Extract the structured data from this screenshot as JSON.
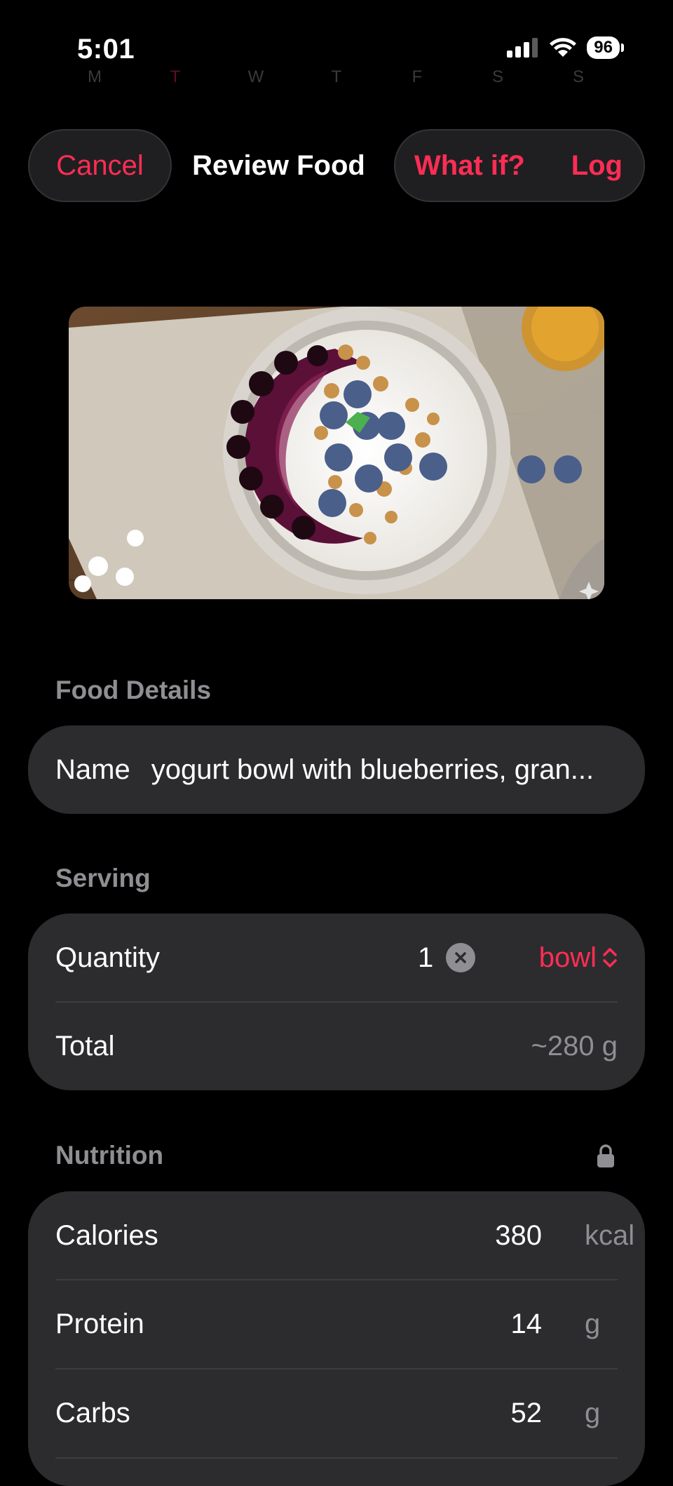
{
  "status_bar": {
    "time": "5:01",
    "battery": "96"
  },
  "week_strip": [
    "M",
    "T",
    "W",
    "T",
    "F",
    "S",
    "S"
  ],
  "nav": {
    "cancel_label": "Cancel",
    "title": "Review Food",
    "what_if_label": "What if?",
    "log_label": "Log"
  },
  "photo": {
    "description_icon": "sparkle-icon"
  },
  "food_details": {
    "section_label": "Food Details",
    "name_label": "Name",
    "name_value": "yogurt bowl with blueberries, gran..."
  },
  "serving": {
    "section_label": "Serving",
    "quantity_label": "Quantity",
    "quantity_value": "1",
    "unit_value": "bowl",
    "total_label": "Total",
    "total_value": "~280 g"
  },
  "nutrition": {
    "section_label": "Nutrition",
    "rows": [
      {
        "label": "Calories",
        "value": "380",
        "unit": "kcal"
      },
      {
        "label": "Protein",
        "value": "14",
        "unit": "g"
      },
      {
        "label": "Carbs",
        "value": "52",
        "unit": "g"
      }
    ]
  },
  "colors": {
    "accent": "#ff2d55",
    "card": "#2c2c2e",
    "secondary_text": "#8e8e93",
    "background": "#000000"
  }
}
